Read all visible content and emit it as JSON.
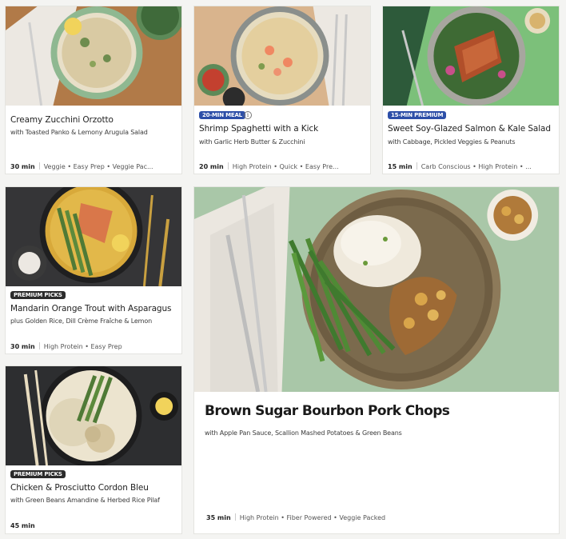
{
  "recipes": [
    {
      "title": "Creamy Zucchini Orzotto",
      "subtitle": "with Toasted Panko & Lemony Arugula Salad",
      "time": "30 min",
      "tags": "Veggie • Easy Prep • Veggie Pac..."
    },
    {
      "badge": "20-MIN MEAL",
      "title": "Shrimp Spaghetti with a Kick",
      "subtitle": "with Garlic Herb Butter & Zucchini",
      "time": "20 min",
      "tags": "High Protein • Quick • Easy Pre..."
    },
    {
      "badge": "15-MIN PREMIUM",
      "title": "Sweet Soy-Glazed Salmon & Kale Salad",
      "subtitle": "with Cabbage, Pickled Veggies & Peanuts",
      "time": "15 min",
      "tags": "Carb Conscious • High Protein • ..."
    },
    {
      "badge": "PREMIUM PICKS",
      "title": "Mandarin Orange Trout with Asparagus",
      "subtitle": "plus Golden Rice, Dill Crème Fraîche & Lemon",
      "time": "30 min",
      "tags": "High Protein • Easy Prep"
    },
    {
      "badge": "PREMIUM PICKS",
      "title": "Chicken & Prosciutto Cordon Bleu",
      "subtitle": "with Green Beans Amandine & Herbed Rice Pilaf",
      "time": "45 min",
      "tags": ""
    },
    {
      "title": "Brown Sugar Bourbon Pork Chops",
      "subtitle": "with Apple Pan Sauce, Scallion Mashed Potatoes & Green Beans",
      "time": "35 min",
      "tags": "High Protein • Fiber Powered • Veggie Packed"
    }
  ],
  "icons": {
    "info": "info-icon"
  },
  "colors": {
    "badge_dark": "#2b2b2b",
    "badge_blue": "#2d4fa8"
  }
}
